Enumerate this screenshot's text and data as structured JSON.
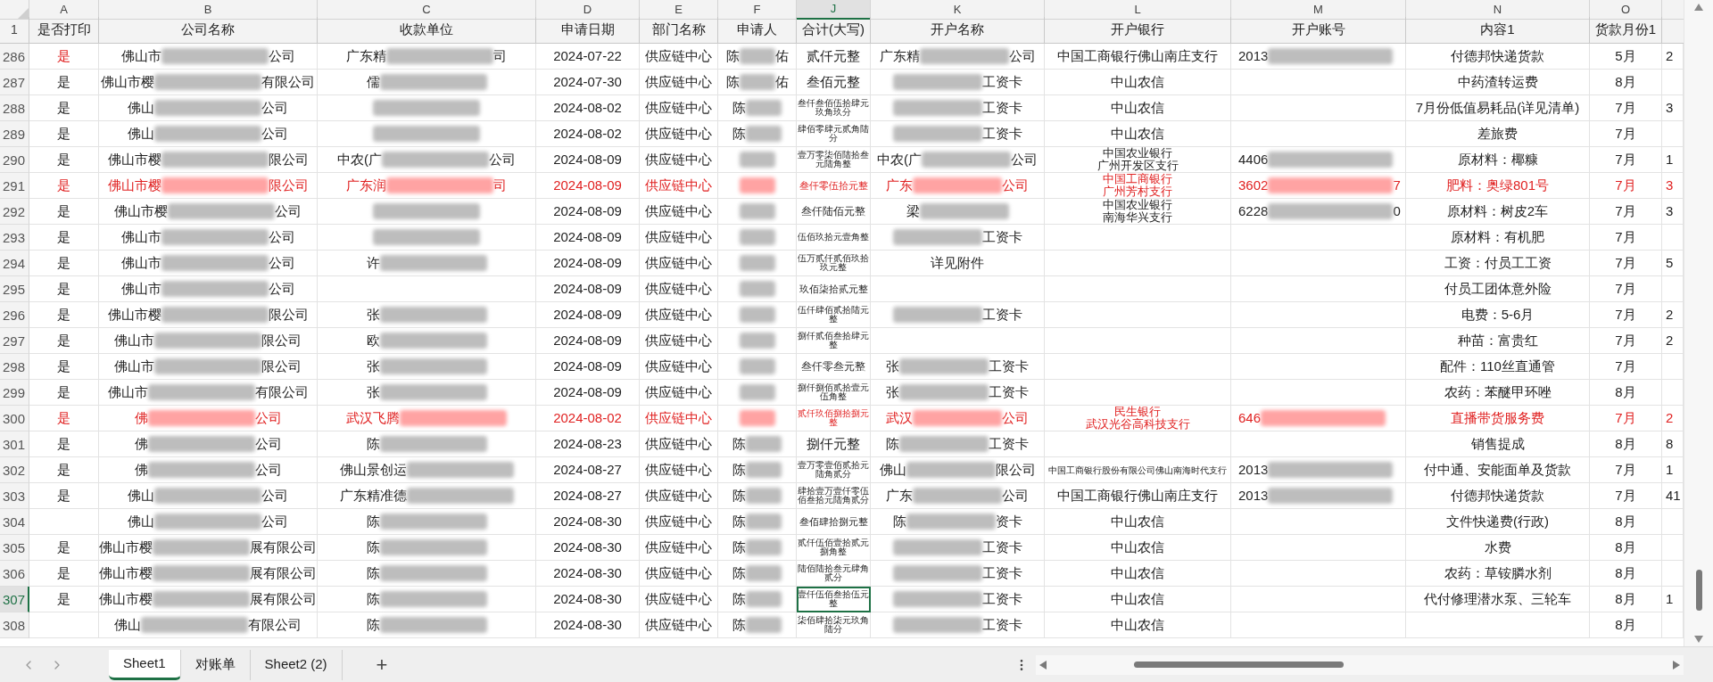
{
  "column_letters": [
    {
      "label": "A",
      "selected": false
    },
    {
      "label": "B",
      "selected": false
    },
    {
      "label": "C",
      "selected": false
    },
    {
      "label": "D",
      "selected": false
    },
    {
      "label": "E",
      "selected": false
    },
    {
      "label": "F",
      "selected": false
    },
    {
      "label": "J",
      "selected": true
    },
    {
      "label": "K",
      "selected": false
    },
    {
      "label": "L",
      "selected": false
    },
    {
      "label": "M",
      "selected": false
    },
    {
      "label": "N",
      "selected": false
    },
    {
      "label": "O",
      "selected": false
    }
  ],
  "header_row": {
    "number": "1",
    "labels": [
      "是否打印",
      "公司名称",
      "收款单位",
      "申请日期",
      "部门名称",
      "申请人",
      "合计(大写)",
      "开户名称",
      "开户银行",
      "开户账号",
      "内容1",
      "货款月份1"
    ]
  },
  "rows": [
    {
      "number": "286",
      "selected": false,
      "red": false,
      "print": {
        "text": "是",
        "red": true
      },
      "company": {
        "pre": "佛山市",
        "post": "公司"
      },
      "payee": {
        "pre": "广东精",
        "post": "司"
      },
      "date": "2024-07-22",
      "dept": "供应链中心",
      "applicant": {
        "pre": "陈",
        "post": "佑"
      },
      "total": "贰仟元整",
      "account_name": {
        "pre": "广东精",
        "post": "公司"
      },
      "bank": "中国工商银行佛山南庄支行",
      "account_no": {
        "pre": "2013"
      },
      "content": "付德邦快递货款",
      "month": "5月",
      "col_p": "2"
    },
    {
      "number": "287",
      "selected": false,
      "red": false,
      "print": {
        "text": "是",
        "red": false
      },
      "company": {
        "pre": "佛山市樱",
        "post": "有限公司"
      },
      "payee": {
        "pre": "儒"
      },
      "date": "2024-07-30",
      "dept": "供应链中心",
      "applicant": {
        "pre": "陈",
        "post": "佑"
      },
      "total": "叁佰元整",
      "account_name": {
        "post": "工资卡"
      },
      "bank": "中山农信",
      "content": "中药渣转运费",
      "month": "8月"
    },
    {
      "number": "288",
      "selected": false,
      "red": false,
      "print": {
        "text": "是",
        "red": false
      },
      "company": {
        "pre": "佛山",
        "post": "公司"
      },
      "payee": {
        "blurred": true
      },
      "date": "2024-08-02",
      "dept": "供应链中心",
      "applicant": {
        "pre": "陈"
      },
      "total": "叁仟叁佰伍拾肆元玖角玖分",
      "account_name": {
        "post": "工资卡"
      },
      "bank": "中山农信",
      "content": "7月份低值易耗品(详见清单)",
      "month": "7月",
      "col_p": "3"
    },
    {
      "number": "289",
      "selected": false,
      "red": false,
      "print": {
        "text": "是",
        "red": false
      },
      "company": {
        "pre": "佛山",
        "post": "公司"
      },
      "payee": {
        "blurred": true
      },
      "date": "2024-08-02",
      "dept": "供应链中心",
      "applicant": {
        "pre": "陈"
      },
      "total": "肆佰零肆元贰角陆分",
      "account_name": {
        "post": "工资卡"
      },
      "bank": "中山农信",
      "content": "差旅费",
      "month": "7月"
    },
    {
      "number": "290",
      "selected": false,
      "red": false,
      "print": {
        "text": "是",
        "red": false
      },
      "company": {
        "pre": "佛山市樱",
        "post": "限公司"
      },
      "payee": {
        "pre": "中农(广",
        "post": "公司"
      },
      "date": "2024-08-09",
      "dept": "供应链中心",
      "applicant": {
        "blurred": true
      },
      "total": "壹万零柒佰陆拾叁元陆角整",
      "account_name": {
        "pre": "中农(广",
        "post": "公司"
      },
      "bank": [
        "中国农业银行",
        "广州开发区支行"
      ],
      "account_no": {
        "pre": "4406"
      },
      "content": "原材料：椰糠",
      "month": "7月",
      "col_p": "1"
    },
    {
      "number": "291",
      "selected": false,
      "red": true,
      "print": {
        "text": "是",
        "red": true
      },
      "company": {
        "pre": "佛山市樱",
        "post": "限公司"
      },
      "payee": {
        "pre": "广东润",
        "post": "司"
      },
      "date": "2024-08-09",
      "dept": "供应链中心",
      "applicant": {
        "blurred": true
      },
      "total": "叁仟零伍拾元整",
      "account_name": {
        "pre": "广东",
        "post": "公司"
      },
      "bank": [
        "中国工商银行",
        "广州芳村支行"
      ],
      "account_no": {
        "pre": "3602",
        "post": "7"
      },
      "content": "肥料：奥绿801号",
      "month": "7月",
      "col_p": "3"
    },
    {
      "number": "292",
      "selected": false,
      "red": false,
      "print": {
        "text": "是",
        "red": false
      },
      "company": {
        "pre": "佛山市樱",
        "post": "公司"
      },
      "payee": {
        "blurred": true
      },
      "date": "2024-08-09",
      "dept": "供应链中心",
      "applicant": {
        "blurred": true
      },
      "total": "叁仟陆佰元整",
      "account_name": {
        "pre": "梁"
      },
      "bank": [
        "中国农业银行",
        "南海华兴支行"
      ],
      "account_no": {
        "pre": "6228",
        "post": "0"
      },
      "content": "原材料：树皮2车",
      "month": "7月",
      "col_p": "3"
    },
    {
      "number": "293",
      "selected": false,
      "red": false,
      "print": {
        "text": "是",
        "red": false
      },
      "company": {
        "pre": "佛山市",
        "post": "公司"
      },
      "payee": {
        "blurred": true
      },
      "date": "2024-08-09",
      "dept": "供应链中心",
      "applicant": {
        "blurred": true
      },
      "total": "伍佰玖拾元壹角整",
      "account_name": {
        "post": "工资卡"
      },
      "content": "原材料：有机肥",
      "month": "7月"
    },
    {
      "number": "294",
      "selected": false,
      "red": false,
      "print": {
        "text": "是",
        "red": false
      },
      "company": {
        "pre": "佛山市",
        "post": "公司"
      },
      "payee": {
        "pre": "许"
      },
      "date": "2024-08-09",
      "dept": "供应链中心",
      "applicant": {
        "blurred": true
      },
      "total": "伍万贰仟贰佰玖拾玖元整",
      "account_name": "详见附件",
      "content": "工资：付员工工资",
      "month": "7月",
      "col_p": "5"
    },
    {
      "number": "295",
      "selected": false,
      "red": false,
      "print": {
        "text": "是",
        "red": false
      },
      "company": {
        "pre": "佛山市",
        "post": "公司"
      },
      "date": "2024-08-09",
      "dept": "供应链中心",
      "applicant": {
        "blurred": true
      },
      "total": "玖佰柒拾贰元整",
      "content": "付员工团体意外险",
      "month": "7月"
    },
    {
      "number": "296",
      "selected": false,
      "red": false,
      "print": {
        "text": "是",
        "red": false
      },
      "company": {
        "pre": "佛山市樱",
        "post": "限公司"
      },
      "payee": {
        "pre": "张"
      },
      "date": "2024-08-09",
      "dept": "供应链中心",
      "applicant": {
        "blurred": true
      },
      "total": "伍仟肆佰贰拾陆元整",
      "account_name": {
        "post": "工资卡"
      },
      "content": "电费：5-6月",
      "month": "7月",
      "col_p": "2"
    },
    {
      "number": "297",
      "selected": false,
      "red": false,
      "print": {
        "text": "是",
        "red": false
      },
      "company": {
        "pre": "佛山市",
        "post": "限公司"
      },
      "payee": {
        "pre": "欧"
      },
      "date": "2024-08-09",
      "dept": "供应链中心",
      "applicant": {
        "blurred": true
      },
      "total": "捌仟贰佰叁拾肆元整",
      "content": "种苗：富贵红",
      "month": "7月",
      "col_p": "2"
    },
    {
      "number": "298",
      "selected": false,
      "red": false,
      "print": {
        "text": "是",
        "red": false
      },
      "company": {
        "pre": "佛山市",
        "post": "限公司"
      },
      "payee": {
        "pre": "张"
      },
      "date": "2024-08-09",
      "dept": "供应链中心",
      "applicant": {
        "blurred": true
      },
      "total": "叁仟零叁元整",
      "account_name": {
        "pre": "张",
        "post": "工资卡"
      },
      "content": "配件：110丝直通管",
      "month": "7月"
    },
    {
      "number": "299",
      "selected": false,
      "red": false,
      "print": {
        "text": "是",
        "red": false
      },
      "company": {
        "pre": "佛山市",
        "post": "有限公司"
      },
      "payee": {
        "pre": "张"
      },
      "date": "2024-08-09",
      "dept": "供应链中心",
      "applicant": {
        "blurred": true
      },
      "total": "捌仟捌佰贰拾壹元伍角整",
      "account_name": {
        "pre": "张",
        "post": "工资卡"
      },
      "content": "农药：苯醚甲环唑",
      "month": "8月"
    },
    {
      "number": "300",
      "selected": false,
      "red": true,
      "print": {
        "text": "是",
        "red": true
      },
      "company": {
        "pre": "佛",
        "post": "公司"
      },
      "payee": {
        "pre": "武汉飞腾"
      },
      "date": "2024-08-02",
      "dept": "供应链中心",
      "applicant": {
        "blurred": true
      },
      "total": "贰仟玖佰捌拾捌元整",
      "account_name": {
        "pre": "武汉",
        "post": "公司"
      },
      "bank": [
        "民生银行",
        "武汉光谷高科技支行"
      ],
      "account_no": {
        "pre": "646"
      },
      "content": "直播带货服务费",
      "month": "7月",
      "col_p": "2"
    },
    {
      "number": "301",
      "selected": false,
      "red": false,
      "print": {
        "text": "是",
        "red": false
      },
      "company": {
        "pre": "佛",
        "post": "公司"
      },
      "payee": {
        "pre": "陈"
      },
      "date": "2024-08-23",
      "dept": "供应链中心",
      "applicant": {
        "pre": "陈"
      },
      "total": "捌仟元整",
      "account_name": {
        "pre": "陈",
        "post": "工资卡"
      },
      "content": "销售提成",
      "month": "8月",
      "col_p": "8"
    },
    {
      "number": "302",
      "selected": false,
      "red": false,
      "print": {
        "text": "是",
        "red": false
      },
      "company": {
        "pre": "佛",
        "post": "公司"
      },
      "payee": {
        "pre": "佛山景创运"
      },
      "date": "2024-08-27",
      "dept": "供应链中心",
      "applicant": {
        "pre": "陈"
      },
      "total": "壹万零壹佰贰拾元陆角贰分",
      "account_name": {
        "pre": "佛山",
        "post": "限公司"
      },
      "bank": "中国工商银行股份有限公司佛山南海时代支行",
      "account_no": {
        "pre": "2013"
      },
      "content": "付中通、安能面单及货款",
      "month": "7月",
      "col_p": "1"
    },
    {
      "number": "303",
      "selected": false,
      "red": false,
      "print": {
        "text": "是",
        "red": false
      },
      "company": {
        "pre": "佛山",
        "post": "公司"
      },
      "payee": {
        "pre": "广东精准德"
      },
      "date": "2024-08-27",
      "dept": "供应链中心",
      "applicant": {
        "pre": "陈"
      },
      "total": "肆拾壹万壹仟零伍佰叁拾元陆角贰分",
      "account_name": {
        "pre": "广东",
        "post": "公司"
      },
      "bank": "中国工商银行佛山南庄支行",
      "account_no": {
        "pre": "2013"
      },
      "content": "付德邦快递货款",
      "month": "7月",
      "col_p": "41"
    },
    {
      "number": "304",
      "selected": false,
      "red": false,
      "company": {
        "pre": "佛山",
        "post": "公司"
      },
      "payee": {
        "pre": "陈"
      },
      "date": "2024-08-30",
      "dept": "供应链中心",
      "applicant": {
        "pre": "陈"
      },
      "total": "叁佰肆拾捌元整",
      "account_name": {
        "pre": "陈",
        "post": "资卡"
      },
      "bank": "中山农信",
      "content": "文件快递费(行政)",
      "month": "8月"
    },
    {
      "number": "305",
      "selected": false,
      "red": false,
      "print": {
        "text": "是",
        "red": false
      },
      "company": {
        "pre": "佛山市樱",
        "post": "展有限公司"
      },
      "payee": {
        "pre": "陈"
      },
      "date": "2024-08-30",
      "dept": "供应链中心",
      "applicant": {
        "pre": "陈"
      },
      "total": "贰仟伍佰壹拾贰元捌角整",
      "account_name": {
        "post": "工资卡"
      },
      "bank": "中山农信",
      "content": "水费",
      "month": "8月"
    },
    {
      "number": "306",
      "selected": false,
      "red": false,
      "print": {
        "text": "是",
        "red": false
      },
      "company": {
        "pre": "佛山市樱",
        "post": "展有限公司"
      },
      "payee": {
        "pre": "陈"
      },
      "date": "2024-08-30",
      "dept": "供应链中心",
      "applicant": {
        "pre": "陈"
      },
      "total": "陆佰陆拾叁元肆角贰分",
      "account_name": {
        "post": "工资卡"
      },
      "bank": "中山农信",
      "content": "农药：草铵膦水剂",
      "month": "8月"
    },
    {
      "number": "307",
      "selected": true,
      "red": false,
      "print": {
        "text": "是",
        "red": false
      },
      "company": {
        "pre": "佛山市樱",
        "post": "展有限公司"
      },
      "payee": {
        "pre": "陈"
      },
      "date": "2024-08-30",
      "dept": "供应链中心",
      "applicant": {
        "pre": "陈"
      },
      "total": "壹仟伍佰叁拾伍元整",
      "account_name": {
        "post": "工资卡"
      },
      "bank": "中山农信",
      "content": "代付修理潜水泵、三轮车",
      "month": "8月",
      "col_p": "1"
    },
    {
      "number": "308",
      "selected": false,
      "red": false,
      "company": {
        "pre": "佛山",
        "post": "有限公司"
      },
      "payee": {
        "pre": "陈"
      },
      "date": "2024-08-30",
      "dept": "供应链中心",
      "applicant": {
        "pre": "陈"
      },
      "total": "柒佰肆拾柒元玖角陆分",
      "account_name": {
        "post": "工资卡"
      },
      "bank": "中山农信",
      "month": "8月"
    }
  ],
  "sheet_tabs": [
    {
      "label": "Sheet1",
      "selected": true
    },
    {
      "label": "对账单",
      "selected": false
    },
    {
      "label": "Sheet2 (2)",
      "selected": false
    }
  ],
  "add_sheet": "+"
}
